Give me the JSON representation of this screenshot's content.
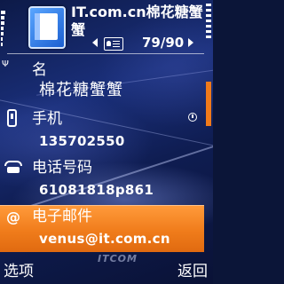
{
  "header": {
    "title": "IT.com.cn棉花糖蟹蟹",
    "app_icon": "contacts-card-icon",
    "counter": "79/90"
  },
  "contact": {
    "fields": [
      {
        "label": "名",
        "value": "棉花糖蟹蟹",
        "icon": ""
      },
      {
        "label": "手机",
        "value": "135702550",
        "icon": "mobile-phone-icon"
      },
      {
        "label": "电话号码",
        "value": "61081818p861",
        "icon": "landline-phone-icon"
      },
      {
        "label": "电子邮件",
        "value": "venus@it.com.cn",
        "icon": "at-sign-icon"
      }
    ],
    "selected_index": 3,
    "default_marker_icon": "default-number-icon"
  },
  "softkeys": {
    "left": "选项",
    "right": "返回"
  },
  "colors": {
    "highlight": "#f07c1b",
    "background": "#1a2f7a",
    "text": "#ffffff"
  }
}
